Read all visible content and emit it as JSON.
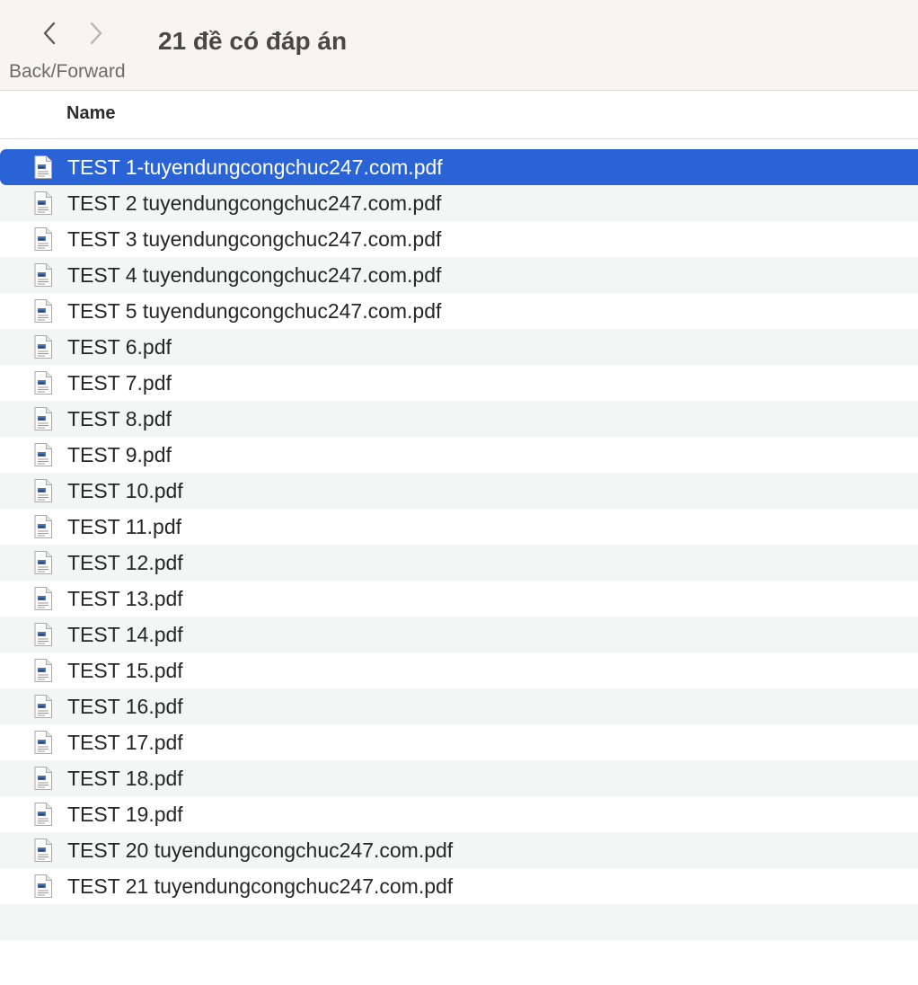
{
  "toolbar": {
    "nav_label": "Back/Forward",
    "title": "21 đề có đáp án"
  },
  "columns": {
    "name": "Name"
  },
  "files": [
    {
      "name": "TEST 1-tuyendungcongchuc247.com.pdf",
      "selected": true
    },
    {
      "name": "TEST 2 tuyendungcongchuc247.com.pdf"
    },
    {
      "name": "TEST 3 tuyendungcongchuc247.com.pdf"
    },
    {
      "name": "TEST 4 tuyendungcongchuc247.com.pdf"
    },
    {
      "name": "TEST 5 tuyendungcongchuc247.com.pdf"
    },
    {
      "name": "TEST 6.pdf"
    },
    {
      "name": "TEST 7.pdf"
    },
    {
      "name": "TEST 8.pdf"
    },
    {
      "name": "TEST 9.pdf"
    },
    {
      "name": "TEST 10.pdf"
    },
    {
      "name": "TEST 11.pdf"
    },
    {
      "name": "TEST 12.pdf"
    },
    {
      "name": "TEST 13.pdf"
    },
    {
      "name": "TEST 14.pdf"
    },
    {
      "name": "TEST 15.pdf"
    },
    {
      "name": "TEST 16.pdf"
    },
    {
      "name": "TEST 17.pdf"
    },
    {
      "name": "TEST 18.pdf"
    },
    {
      "name": "TEST 19.pdf"
    },
    {
      "name": "TEST 20 tuyendungcongchuc247.com.pdf"
    },
    {
      "name": "TEST 21 tuyendungcongchuc247.com.pdf"
    }
  ],
  "icons": {
    "back": "chevron-left-icon",
    "forward": "chevron-right-icon",
    "file": "pdf-file-icon"
  },
  "colors": {
    "selection": "#2963d6",
    "toolbar_bg": "#f7f4f2",
    "alt_row": "#f4f5f5"
  }
}
